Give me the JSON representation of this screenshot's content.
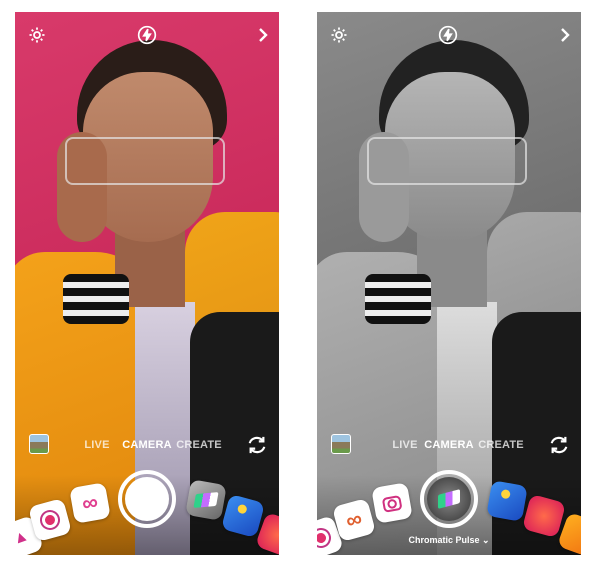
{
  "screens": [
    {
      "modes": [
        "LIVE",
        "CAMERA",
        "CREATE"
      ],
      "active_mode": "CAMERA",
      "filter_label": ""
    },
    {
      "modes": [
        "LIVE",
        "CAMERA",
        "CREATE"
      ],
      "active_mode": "CAMERA",
      "filter_label": "Chromatic Pulse"
    }
  ],
  "icons": {
    "settings": "gear-icon",
    "flash": "flash-icon",
    "next": "chevron-right-icon",
    "flip": "camera-flip-icon",
    "gallery": "gallery-thumbnail"
  },
  "colors": {
    "background_left": "#d83a6a",
    "jacket": "#f4a21a"
  }
}
